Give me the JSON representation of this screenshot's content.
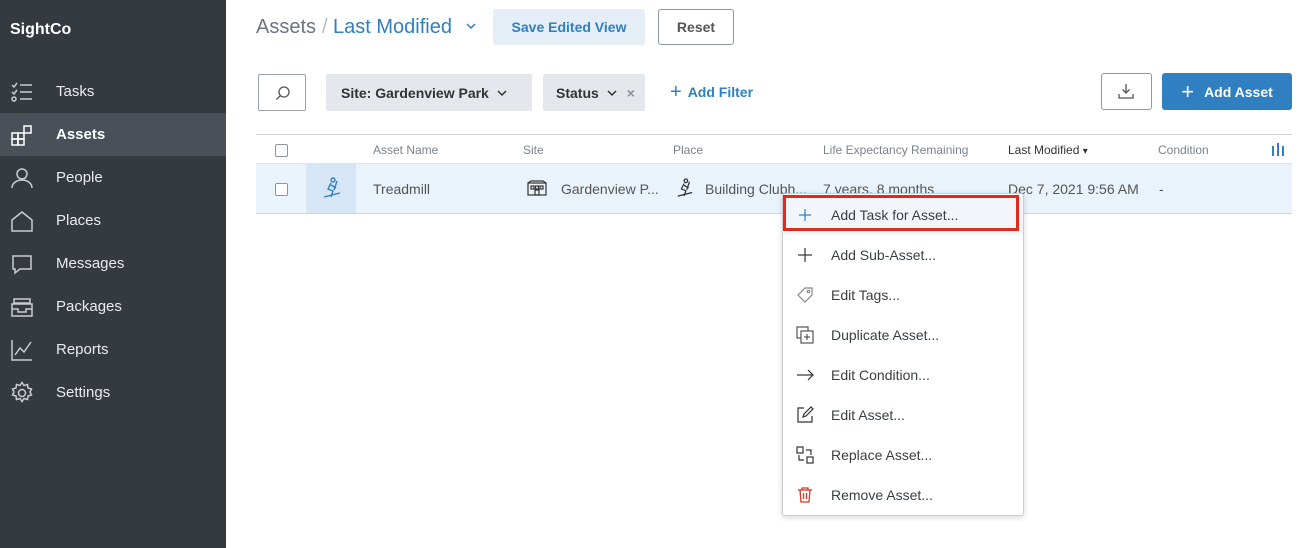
{
  "app": {
    "name": "SightCo"
  },
  "sidebar": {
    "items": [
      {
        "label": "Tasks",
        "icon": "tasks-icon"
      },
      {
        "label": "Assets",
        "icon": "assets-icon",
        "active": true
      },
      {
        "label": "People",
        "icon": "person-icon"
      },
      {
        "label": "Places",
        "icon": "house-icon"
      },
      {
        "label": "Messages",
        "icon": "chat-bubble-icon"
      },
      {
        "label": "Packages",
        "icon": "package-icon"
      },
      {
        "label": "Reports",
        "icon": "line-chart-icon"
      },
      {
        "label": "Settings",
        "icon": "gear-icon"
      }
    ]
  },
  "header": {
    "breadcrumb_root": "Assets",
    "separator": "/",
    "view_name": "Last Modified",
    "save_view_label": "Save Edited View",
    "reset_label": "Reset"
  },
  "filters": {
    "site_chip": "Site: Gardenview Park",
    "status_chip": "Status",
    "status_clear": "×",
    "add_filter_label": "Add Filter",
    "add_filter_plus": "+"
  },
  "actions": {
    "add_asset_plus": "+",
    "add_asset_label": "Add Asset"
  },
  "table": {
    "columns": [
      "Asset Name",
      "Site",
      "Place",
      "Life Expectancy Remaining",
      "Last Modified",
      "Condition"
    ],
    "sort_indicator": "▾",
    "rows": [
      {
        "name": "Treadmill",
        "site": "Gardenview P...",
        "place": "Building Clubh...",
        "life_expectancy": "7 years, 8 months",
        "last_modified": "Dec 7, 2021 9:56 AM",
        "condition": "-"
      }
    ]
  },
  "context_menu": {
    "items": [
      {
        "label": "Add Task for Asset...",
        "icon": "plus-icon",
        "highlighted": true
      },
      {
        "label": "Add Sub-Asset...",
        "icon": "plus-icon"
      },
      {
        "label": "Edit Tags...",
        "icon": "tag-icon"
      },
      {
        "label": "Duplicate Asset...",
        "icon": "duplicate-icon"
      },
      {
        "label": "Edit Condition...",
        "icon": "arrow-right-icon"
      },
      {
        "label": "Edit Asset...",
        "icon": "edit-icon"
      },
      {
        "label": "Replace Asset...",
        "icon": "replace-icon"
      },
      {
        "label": "Remove Asset...",
        "icon": "trash-icon"
      }
    ]
  },
  "colors": {
    "sidebar_bg": "#353a40",
    "accent": "#2f7fc1",
    "highlight_border": "#e02a1d",
    "row_selected_bg": "#eaf2fb"
  }
}
